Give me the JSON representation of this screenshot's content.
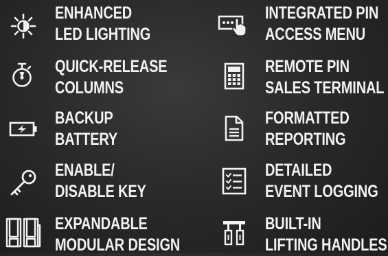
{
  "colors": {
    "text": "#f2f2f2",
    "icon": "#f2f2f2",
    "background": "#2b2b2b"
  },
  "features": [
    {
      "icon": "led-light-icon",
      "line1": "ENHANCED",
      "line2": "LED LIGHTING"
    },
    {
      "icon": "stopwatch-icon",
      "line1": "QUICK-RELEASE",
      "line2": "COLUMNS"
    },
    {
      "icon": "battery-icon",
      "line1": "BACKUP",
      "line2": "BATTERY"
    },
    {
      "icon": "key-icon",
      "line1": "ENABLE/",
      "line2": "DISABLE KEY"
    },
    {
      "icon": "modular-columns-icon",
      "line1": "EXPANDABLE",
      "line2": "MODULAR DESIGN"
    },
    {
      "icon": "pin-touch-icon",
      "line1": "INTEGRATED PIN",
      "line2": "ACCESS MENU"
    },
    {
      "icon": "calculator-terminal-icon",
      "line1": "REMOTE PIN",
      "line2": "SALES TERMINAL"
    },
    {
      "icon": "document-icon",
      "line1": "FORMATTED",
      "line2": "REPORTING"
    },
    {
      "icon": "checklist-icon",
      "line1": "DETAILED",
      "line2": "EVENT LOGGING"
    },
    {
      "icon": "lifting-handles-icon",
      "line1": "BUILT-IN",
      "line2": "LIFTING HANDLES"
    }
  ]
}
